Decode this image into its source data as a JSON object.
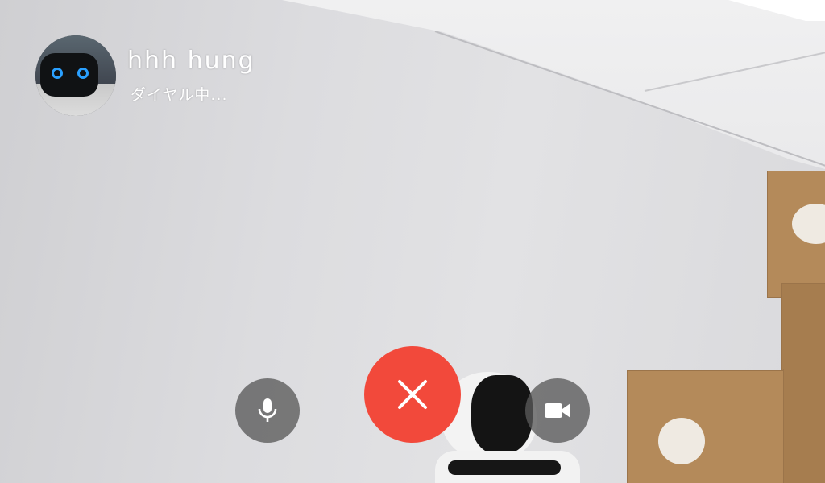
{
  "call": {
    "caller_name": "hhh hung",
    "status": "ダイヤル中..."
  },
  "controls": {
    "mute_icon": "microphone-icon",
    "hangup_icon": "close-icon",
    "video_icon": "video-camera-icon"
  },
  "colors": {
    "hangup": "#f2493b",
    "control_bg": "#5a5a5a",
    "text": "#ffffff"
  }
}
